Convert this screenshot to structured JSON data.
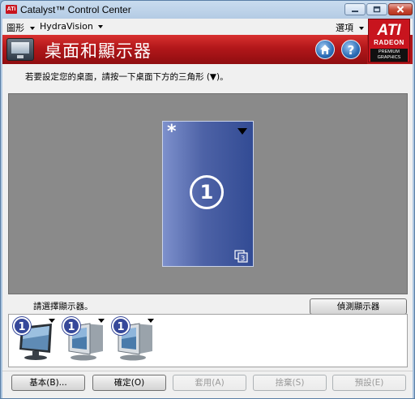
{
  "window": {
    "title": "Catalyst™ Control Center"
  },
  "menubar": {
    "graphics": "圖形",
    "hydravision": "HydraVision",
    "options": "選項"
  },
  "banner": {
    "title": "桌面和顯示器",
    "home_icon": "home-icon",
    "help_icon": "help-icon"
  },
  "logo": {
    "brand": "ATI",
    "product": "RADEON",
    "tagline_1": "PREMIUM",
    "tagline_2": "GRAPHICS"
  },
  "main": {
    "instruction": "若要設定您的桌面，請按一下桌面下方的三角形 (▼)。",
    "desktop": {
      "primary_mark": "*",
      "display_number": "1",
      "display_count": "3"
    },
    "choose_label": "請選擇顯示器。",
    "detect_button": "偵測顯示器",
    "monitors": [
      {
        "number": "1",
        "type": "lcd"
      },
      {
        "number": "1",
        "type": "crt"
      },
      {
        "number": "1",
        "type": "crt"
      }
    ]
  },
  "footer": {
    "basic": "基本(B)...",
    "ok": "確定(O)",
    "apply": "套用(A)",
    "discard": "捨棄(S)",
    "defaults": "預設(E)"
  }
}
